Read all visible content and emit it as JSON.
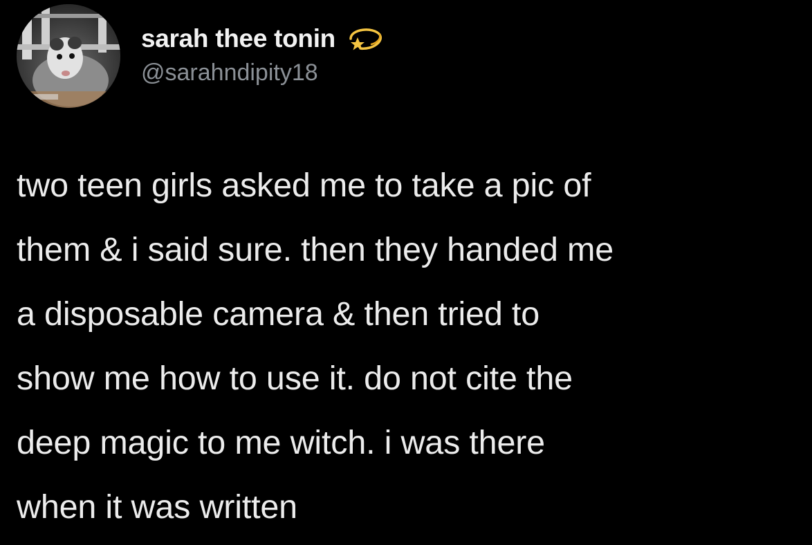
{
  "tweet": {
    "author": {
      "display_name": "sarah thee tonin",
      "handle": "@sarahndipity18",
      "avatar_icon": "opossum-avatar-icon",
      "name_emoji_icon": "dizzy-star-emoji-icon"
    },
    "text_lines": [
      "two teen girls asked me to take a pic of",
      "them & i said sure. then they handed me",
      "a disposable camera & then tried to",
      "show me how to use it. do not cite the",
      "deep magic to me witch. i was there",
      "when it was written"
    ]
  },
  "colors": {
    "background": "#000000",
    "text": "#ececec",
    "handle": "#8b9096"
  }
}
